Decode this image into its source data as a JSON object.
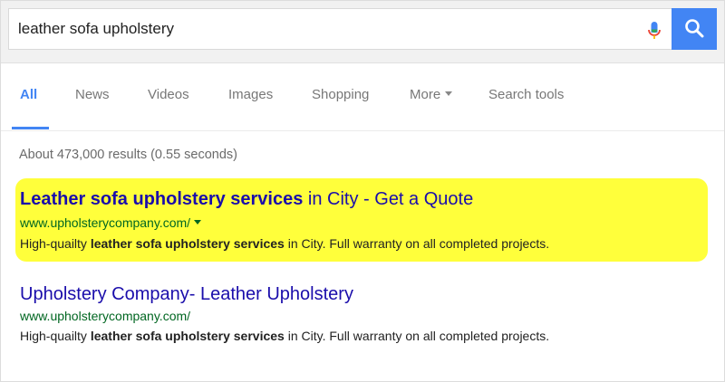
{
  "search": {
    "query": "leather sofa upholstery",
    "mic_icon": "microphone-icon",
    "button_icon": "search-icon",
    "button_color": "#4285f4"
  },
  "tabs": [
    {
      "label": "All",
      "active": true
    },
    {
      "label": "News"
    },
    {
      "label": "Videos"
    },
    {
      "label": "Images"
    },
    {
      "label": "Shopping"
    },
    {
      "label": "More",
      "has_caret": true
    },
    {
      "label": "Search tools"
    }
  ],
  "stats": "About 473,000 results (0.55 seconds)",
  "results": [
    {
      "type": "ad",
      "highlight_color": "#ffff3b",
      "title_bold": "Leather sofa upholstery services",
      "title_rest": " in City - Get a Quote",
      "url": "www.upholsterycompany.com/",
      "url_has_caret": true,
      "snippet_pre": "High-quailty ",
      "snippet_bold": "leather sofa upholstery services",
      "snippet_post": " in City. Full warranty on all completed projects."
    },
    {
      "type": "organic",
      "title": "Upholstery Company- Leather Upholstery",
      "url": "www.upholsterycompany.com/",
      "snippet_pre": "High-quailty ",
      "snippet_bold": "leather sofa upholstery services",
      "snippet_post": " in City. Full warranty on all completed projects."
    }
  ]
}
